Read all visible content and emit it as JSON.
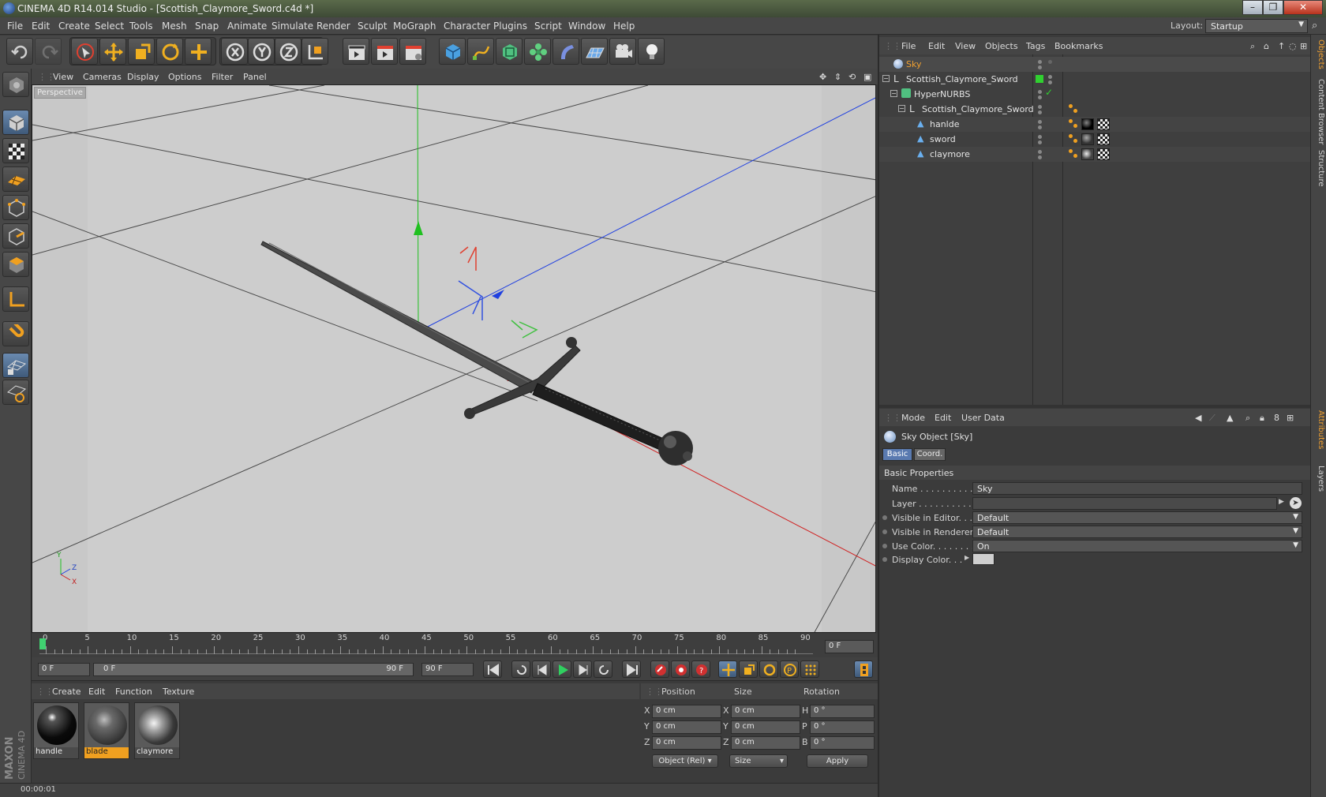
{
  "window": {
    "title": "CINEMA 4D R14.014 Studio - [Scottish_Claymore_Sword.c4d *]",
    "min": "–",
    "max": "❐",
    "close": "✕"
  },
  "menubar": {
    "items": [
      "File",
      "Edit",
      "Create",
      "Select",
      "Tools",
      "Mesh",
      "Snap",
      "Animate",
      "Simulate",
      "Render",
      "Sculpt",
      "MoGraph",
      "Character",
      "Plugins",
      "Script",
      "Window",
      "Help"
    ],
    "layout_label": "Layout:",
    "layout_value": "Startup"
  },
  "viewport": {
    "menu": [
      "View",
      "Cameras",
      "Display",
      "Options",
      "Filter",
      "Panel"
    ],
    "label": "Perspective",
    "axis_labels": {
      "y": "Y",
      "z": "Z",
      "x": "X"
    }
  },
  "timeline": {
    "ticks": [
      "0",
      "5",
      "10",
      "15",
      "20",
      "25",
      "30",
      "35",
      "40",
      "45",
      "50",
      "55",
      "60",
      "65",
      "70",
      "75",
      "80",
      "85",
      "90"
    ],
    "current_frame": "0 F",
    "start_field": "0 F",
    "range_start": "0 F",
    "range_end": "90 F",
    "end_field": "90 F"
  },
  "material_manager": {
    "menu": [
      "Create",
      "Edit",
      "Function",
      "Texture"
    ],
    "materials": [
      {
        "name": "handle",
        "selected": false
      },
      {
        "name": "blade",
        "selected": true
      },
      {
        "name": "claymore",
        "selected": false
      }
    ]
  },
  "coordinates": {
    "headers": [
      "Position",
      "Size",
      "Rotation"
    ],
    "rows": [
      {
        "axis": "X",
        "pos": "0 cm",
        "size_axis": "X",
        "size": "0 cm",
        "rot_axis": "H",
        "rot": "0 °"
      },
      {
        "axis": "Y",
        "pos": "0 cm",
        "size_axis": "Y",
        "size": "0 cm",
        "rot_axis": "P",
        "rot": "0 °"
      },
      {
        "axis": "Z",
        "pos": "0 cm",
        "size_axis": "Z",
        "size": "0 cm",
        "rot_axis": "B",
        "rot": "0 °"
      }
    ],
    "mode": "Object (Rel)",
    "size_mode": "Size",
    "apply": "Apply"
  },
  "status": {
    "time": "00:00:01"
  },
  "object_manager": {
    "menu": [
      "File",
      "Edit",
      "View",
      "Objects",
      "Tags",
      "Bookmarks"
    ],
    "objects": [
      {
        "name": "Sky",
        "level": 0,
        "highlight": true
      },
      {
        "name": "Scottish_Claymore_Sword",
        "level": 0,
        "highlight": false
      },
      {
        "name": "HyperNURBS",
        "level": 1,
        "highlight": false
      },
      {
        "name": "Scottish_Claymore_Sword",
        "level": 2,
        "highlight": false
      },
      {
        "name": "hanlde",
        "level": 3,
        "highlight": false
      },
      {
        "name": "sword",
        "level": 3,
        "highlight": false
      },
      {
        "name": "claymore",
        "level": 3,
        "highlight": false
      }
    ]
  },
  "attribute_manager": {
    "menu": [
      "Mode",
      "Edit",
      "User Data"
    ],
    "object_title": "Sky Object [Sky]",
    "tabs": [
      "Basic",
      "Coord."
    ],
    "section": "Basic Properties",
    "fields": [
      {
        "label": "Name . . . . . . . . . . . .",
        "value": "Sky"
      },
      {
        "label": "Layer . . . . . . . . . . . .",
        "value": ""
      },
      {
        "label": "Visible in Editor. . .",
        "value": "Default"
      },
      {
        "label": "Visible in Renderer",
        "value": "Default"
      },
      {
        "label": "Use Color. . . . . . . .",
        "value": "On"
      },
      {
        "label": "Display Color. . .",
        "value": ""
      }
    ]
  },
  "right_tabs": [
    "Objects",
    "Content Browser",
    "Structure",
    "Attributes",
    "Layers"
  ],
  "brand": "MAXON CINEMA 4D",
  "colors": {
    "accent": "#f0a020",
    "x_axis": "#e02020",
    "y_axis": "#20c020",
    "z_axis": "#2040e0"
  }
}
